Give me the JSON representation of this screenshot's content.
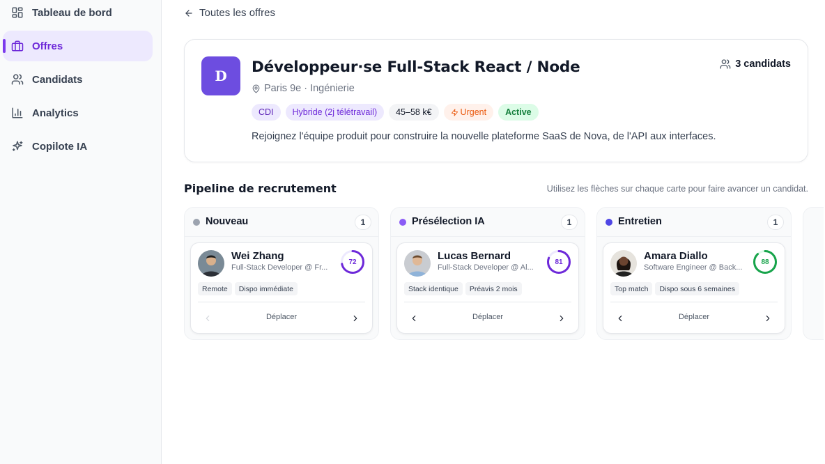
{
  "sidebar": {
    "items": [
      {
        "label": "Tableau de bord",
        "icon": "dashboard-icon",
        "active": false
      },
      {
        "label": "Offres",
        "icon": "briefcase-icon",
        "active": true
      },
      {
        "label": "Candidats",
        "icon": "users-icon",
        "active": false
      },
      {
        "label": "Analytics",
        "icon": "bar-chart-icon",
        "active": false
      },
      {
        "label": "Copilote IA",
        "icon": "sparkles-icon",
        "active": false
      }
    ]
  },
  "back_link": {
    "label": "Toutes les offres"
  },
  "job": {
    "logo_letter": "D",
    "title": "Développeur·se Full-Stack React / Node",
    "location": "Paris 9e · Ingénierie",
    "candidates_count": "3 candidats",
    "tags": {
      "contract": "CDI",
      "remote": "Hybride (2j télétravail)",
      "salary": "45–58 k€",
      "urgent": "Urgent",
      "status": "Active"
    },
    "description": "Rejoignez l'équipe produit pour construire la nouvelle plateforme SaaS de Nova, de l'API aux interfaces."
  },
  "pipeline": {
    "title": "Pipeline de recrutement",
    "hint": "Utilisez les flèches sur chaque carte pour faire avancer un candidat.",
    "move_label": "Déplacer",
    "columns": [
      {
        "title": "Nouveau",
        "count": "1",
        "dot_color": "#9ca3af",
        "candidate": {
          "name": "Wei Zhang",
          "role": "Full-Stack Developer @ Fr...",
          "score": "72",
          "score_fraction": 0.72,
          "score_color": "#6d28d9",
          "tags": [
            "Remote",
            "Dispo immédiate"
          ]
        }
      },
      {
        "title": "Présélection IA",
        "count": "1",
        "dot_color": "#8b5cf6",
        "candidate": {
          "name": "Lucas Bernard",
          "role": "Full-Stack Developer @ Al...",
          "score": "81",
          "score_fraction": 0.81,
          "score_color": "#6d28d9",
          "tags": [
            "Stack identique",
            "Préavis 2 mois"
          ]
        }
      },
      {
        "title": "Entretien",
        "count": "1",
        "dot_color": "#4f46e5",
        "candidate": {
          "name": "Amara Diallo",
          "role": "Software Engineer @ Back...",
          "score": "88",
          "score_fraction": 0.88,
          "score_color": "#16a34a",
          "tags": [
            "Top match",
            "Dispo sous 6 semaines"
          ]
        }
      }
    ]
  },
  "colors": {
    "accent": "#6d28d9",
    "accent_bg": "#ede9fe",
    "success": "#16a34a",
    "urgent": "#ea580c"
  }
}
